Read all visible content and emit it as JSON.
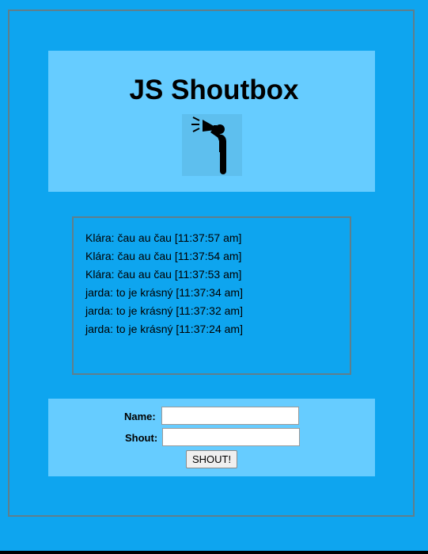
{
  "header": {
    "title": "JS Shoutbox",
    "icon": "megaphone-icon"
  },
  "messages": [
    {
      "text": "Klára: čau au čau [11:37:57 am]"
    },
    {
      "text": "Klára: čau au čau [11:37:54 am]"
    },
    {
      "text": "Klára: čau au čau [11:37:53 am]"
    },
    {
      "text": "jarda: to je krásný [11:37:34 am]"
    },
    {
      "text": "jarda: to je krásný [11:37:32 am]"
    },
    {
      "text": "jarda: to je krásný [11:37:24 am]"
    }
  ],
  "form": {
    "name_label": "Name:",
    "name_value": "",
    "shout_label": "Shout:",
    "shout_value": "",
    "submit_label": "SHOUT!"
  },
  "colors": {
    "background": "#0ea5ef",
    "panel": "#66ccff",
    "border": "#5f7f8c"
  }
}
